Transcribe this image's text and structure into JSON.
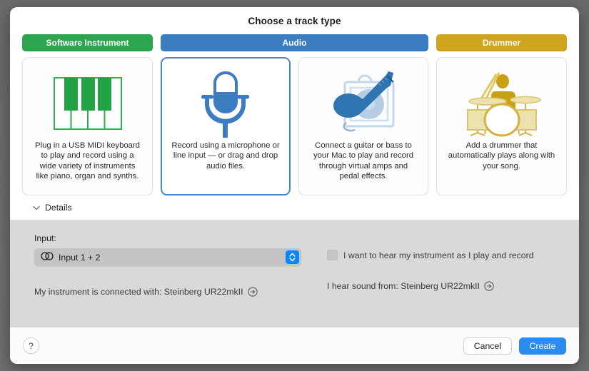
{
  "dialog": {
    "title": "Choose a track type"
  },
  "tabs": [
    {
      "id": "software-instrument",
      "label": "Software Instrument",
      "color": "#2da44e"
    },
    {
      "id": "audio",
      "label": "Audio",
      "color": "#3b7dc0",
      "selected": true
    },
    {
      "id": "drummer",
      "label": "Drummer",
      "color": "#cfa51f"
    }
  ],
  "cards": [
    {
      "id": "software-instrument",
      "icon": "piano-keyboard-icon",
      "description": "Plug in a USB MIDI keyboard to play and record using a wide variety of instruments like piano, organ and synths.",
      "selected": false
    },
    {
      "id": "audio",
      "icon": "microphone-icon",
      "description": "Record using a microphone or line input — or drag and drop audio files.",
      "selected": true
    },
    {
      "id": "guitar-bass",
      "icon": "guitar-amp-icon",
      "description": "Connect a guitar or bass to your Mac to play and record through virtual amps and pedal effects.",
      "selected": false
    },
    {
      "id": "drummer",
      "icon": "drummer-kit-icon",
      "description": "Add a drummer that automatically plays along with your song.",
      "selected": false
    }
  ],
  "details": {
    "label": "Details",
    "expanded": true,
    "input_label": "Input:",
    "input_value": "Input 1 + 2",
    "input_icon": "stereo-pair-icon",
    "monitor_checkbox_label": "I want to hear my instrument as I play and record",
    "monitor_checked": false,
    "instrument_connection_text": "My instrument is connected with: Steinberg UR22mkII",
    "sound_output_text": "I hear sound from: Steinberg UR22mkII"
  },
  "footer": {
    "help_label": "?",
    "cancel_label": "Cancel",
    "create_label": "Create",
    "create_color": "#2b8cf0"
  }
}
